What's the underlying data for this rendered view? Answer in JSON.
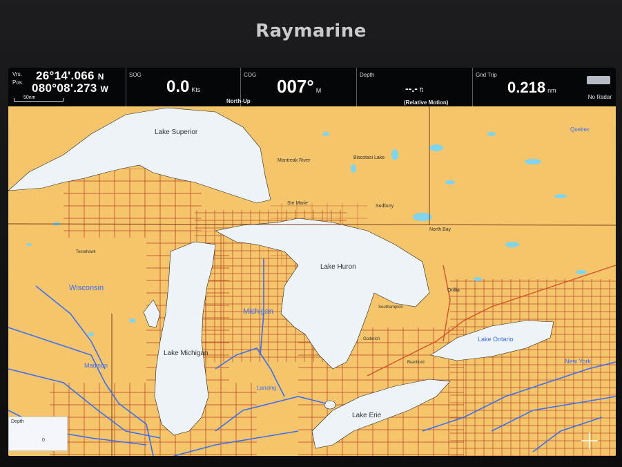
{
  "device": {
    "brand": "Raymarine"
  },
  "databar": {
    "position": {
      "label_lat": "Vrs.",
      "label_lon": "Pos.",
      "lat": "26°14'.066",
      "lat_hem": "N",
      "lon": "080°08'.273",
      "lon_hem": "W",
      "scale": "50nm"
    },
    "sog": {
      "label": "SOG",
      "value": "0.0",
      "unit": "Kts"
    },
    "cog": {
      "label": "COG",
      "value": "007°",
      "unit": "M",
      "mode": "North-Up"
    },
    "depth": {
      "label": "Depth",
      "value": "--.-",
      "unit": "ft",
      "motion": "(Relative Motion)"
    },
    "trip": {
      "label": "Gnd Trip",
      "value": "0.218",
      "unit": "nm"
    },
    "radar": {
      "label": "No Radar"
    }
  },
  "map": {
    "colors": {
      "land": "#f4c56a",
      "water": "#eef3f8",
      "chart_lines": "#b5341f",
      "roads": "#3d6df2",
      "borders": "#7a3b1a"
    },
    "labels": {
      "lake_superior": "Lake Superior",
      "lake_michigan": "Lake Michigan",
      "lake_huron": "Lake Huron",
      "lake_erie": "Lake Erie",
      "lake_ontario": "Lake Ontario",
      "michigan": "Michigan",
      "wisconsin": "Wisconsin",
      "madison": "Madison",
      "new_york": "New York",
      "montreal_river": "Montreak River",
      "biscotasi_lake": "Biscotasi Lake",
      "sudbury": "Sudbury",
      "north_bay": "North Bay",
      "sault_ste_marie": "Ste Marie",
      "orillia": "Orillia",
      "lansing": "Lansing",
      "goderich": "Goderich",
      "southampton": "Southampton",
      "brantford": "Brantford",
      "quebec": "Quebec",
      "tomahawk": "Tomahawk"
    },
    "depth_legend": {
      "label": "Depth",
      "value": "0"
    }
  }
}
